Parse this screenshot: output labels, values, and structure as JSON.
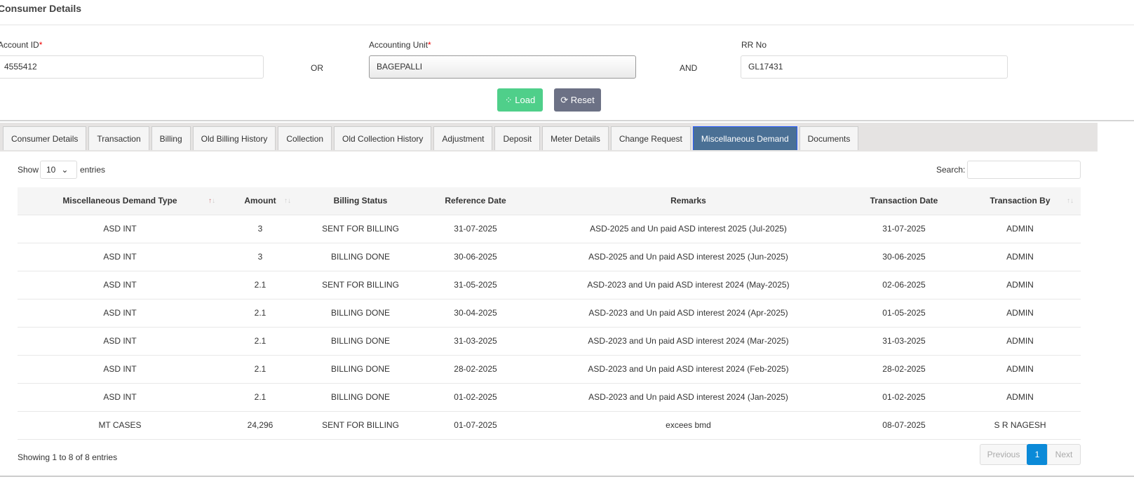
{
  "page_title": "Consumer Details",
  "form": {
    "account_id_label": "Account ID",
    "account_id_value": "4555412",
    "required_mark": "*",
    "or_label": "OR",
    "unit_label": "Accounting Unit",
    "unit_value": "BAGEPALLI",
    "and_label": "AND",
    "rr_label": "RR No",
    "rr_value": "GL17431",
    "load_label": "Load",
    "reset_label": "Reset",
    "load_color": "#4fcf8a",
    "reset_color": "#6c7185"
  },
  "tabs": [
    {
      "label": "Consumer Details"
    },
    {
      "label": "Transaction"
    },
    {
      "label": "Billing"
    },
    {
      "label": "Old Billing History"
    },
    {
      "label": "Collection"
    },
    {
      "label": "Old Collection History"
    },
    {
      "label": "Adjustment"
    },
    {
      "label": "Deposit"
    },
    {
      "label": "Meter Details"
    },
    {
      "label": "Change Request"
    },
    {
      "label": "Miscellaneous Demand",
      "active": true
    },
    {
      "label": "Documents"
    }
  ],
  "table": {
    "show_label": "Show",
    "entries_value": "10",
    "entries_label": "entries",
    "search_label": "Search:",
    "columns": [
      "Miscellaneous Demand Type",
      "Amount",
      "Billing Status",
      "Reference Date",
      "Remarks",
      "Transaction Date",
      "Transaction By"
    ],
    "rows": [
      [
        "ASD INT",
        "3",
        "SENT FOR BILLING",
        "31-07-2025",
        "ASD-2025 and Un paid ASD interest 2025 (Jul-2025)",
        "31-07-2025",
        "ADMIN"
      ],
      [
        "ASD INT",
        "3",
        "BILLING DONE",
        "30-06-2025",
        "ASD-2025 and Un paid ASD interest 2025 (Jun-2025)",
        "30-06-2025",
        "ADMIN"
      ],
      [
        "ASD INT",
        "2.1",
        "SENT FOR BILLING",
        "31-05-2025",
        "ASD-2023 and Un paid ASD interest 2024 (May-2025)",
        "02-06-2025",
        "ADMIN"
      ],
      [
        "ASD INT",
        "2.1",
        "BILLING DONE",
        "30-04-2025",
        "ASD-2023 and Un paid ASD interest 2024 (Apr-2025)",
        "01-05-2025",
        "ADMIN"
      ],
      [
        "ASD INT",
        "2.1",
        "BILLING DONE",
        "31-03-2025",
        "ASD-2023 and Un paid ASD interest 2024 (Mar-2025)",
        "31-03-2025",
        "ADMIN"
      ],
      [
        "ASD INT",
        "2.1",
        "BILLING DONE",
        "28-02-2025",
        "ASD-2023 and Un paid ASD interest 2024 (Feb-2025)",
        "28-02-2025",
        "ADMIN"
      ],
      [
        "ASD INT",
        "2.1",
        "BILLING DONE",
        "01-02-2025",
        "ASD-2023 and Un paid ASD interest 2024 (Jan-2025)",
        "01-02-2025",
        "ADMIN"
      ],
      [
        "MT CASES",
        "24,296",
        "SENT FOR BILLING",
        "01-07-2025",
        "excees bmd",
        "08-07-2025",
        "S R NAGESH"
      ]
    ],
    "info": "Showing 1 to 8 of 8 entries",
    "prev_label": "Previous",
    "page": "1",
    "next_label": "Next"
  }
}
